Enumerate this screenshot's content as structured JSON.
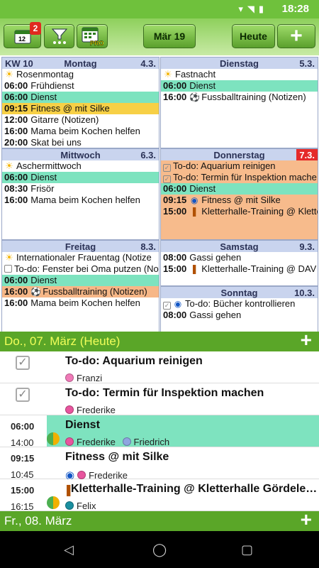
{
  "status": {
    "time": "18:28"
  },
  "toolbar": {
    "badge": "2",
    "date_label": "Mär 19",
    "today_label": "Heute",
    "add_label": "+"
  },
  "week": {
    "kw": "KW 10",
    "days": [
      {
        "name": "Montag",
        "date": "4.3."
      },
      {
        "name": "Dienstag",
        "date": "5.3."
      },
      {
        "name": "Mittwoch",
        "date": "6.3."
      },
      {
        "name": "Donnerstag",
        "date": "7.3."
      },
      {
        "name": "Freitag",
        "date": "8.3."
      },
      {
        "name": "Samstag",
        "date": "9.3."
      },
      {
        "name": "Sonntag",
        "date": "10.3."
      }
    ],
    "mon": [
      {
        "text": "Rosenmontag"
      },
      {
        "time": "06:00",
        "text": "Frühdienst"
      },
      {
        "time": "06:00",
        "text": "Dienst"
      },
      {
        "time": "09:15",
        "text": "Fitness @ mit Silke"
      },
      {
        "time": "12:00",
        "text": "Gitarre (Notizen)"
      },
      {
        "time": "16:00",
        "text": "Mama beim Kochen helfen"
      },
      {
        "time": "20:00",
        "text": "Skat bei uns"
      }
    ],
    "tue": [
      {
        "text": "Fastnacht"
      },
      {
        "time": "06:00",
        "text": "Dienst"
      },
      {
        "time": "16:00",
        "text": "Fussballtraining (Notizen)"
      }
    ],
    "wed": [
      {
        "text": "Aschermittwoch"
      },
      {
        "time": "06:00",
        "text": "Dienst"
      },
      {
        "time": "08:30",
        "text": "Frisör"
      },
      {
        "time": "16:00",
        "text": "Mama beim Kochen helfen"
      }
    ],
    "thu": [
      {
        "text": "To-do: Aquarium reinigen"
      },
      {
        "text": "To-do: Termin für Inspektion mache"
      },
      {
        "time": "06:00",
        "text": "Dienst"
      },
      {
        "time": "09:15",
        "text": "Fitness @ mit Silke"
      },
      {
        "time": "15:00",
        "text": "Kletterhalle-Training @ Kletterh"
      }
    ],
    "fri": [
      {
        "text": "Internationaler Frauentag (Notize"
      },
      {
        "text": "To-do: Fenster bei Oma putzen (No"
      },
      {
        "time": "06:00",
        "text": "Dienst"
      },
      {
        "time": "16:00",
        "text": "Fussballtraining (Notizen)"
      },
      {
        "time": "16:00",
        "text": "Mama beim Kochen helfen"
      }
    ],
    "sat": [
      {
        "time": "08:00",
        "text": "Gassi gehen"
      },
      {
        "time": "15:00",
        "text": "Kletterhalle-Training @ DAV K"
      }
    ],
    "sun": [
      {
        "text": "To-do: Bücher kontrollieren"
      },
      {
        "time": "08:00",
        "text": "Gassi gehen"
      }
    ]
  },
  "agenda": {
    "day1": "Do., 07. März (Heute)",
    "day2": "Fr., 08. März",
    "items": [
      {
        "title": "To-do: Aquarium reinigen",
        "people": [
          "Franzi"
        ]
      },
      {
        "title": "To-do: Termin für Inspektion machen",
        "people": [
          "Frederike"
        ]
      },
      {
        "start": "06:00",
        "end": "14:00",
        "title": "Dienst",
        "people": [
          "Frederike",
          "Friedrich"
        ]
      },
      {
        "start": "09:15",
        "end": "10:45",
        "title": "Fitness @ mit Silke",
        "people": [
          "Frederike"
        ]
      },
      {
        "start": "15:00",
        "end": "16:15",
        "title": "Kletterhalle-Training @ Kletterhalle Gördele…",
        "people": [
          "Felix"
        ]
      }
    ]
  },
  "colors": {
    "accent_green": "#5aa628",
    "event_green": "#7de3bf",
    "event_yellow": "#f7d046",
    "event_orange": "#f7b787",
    "today_red": "#e52a2a"
  }
}
